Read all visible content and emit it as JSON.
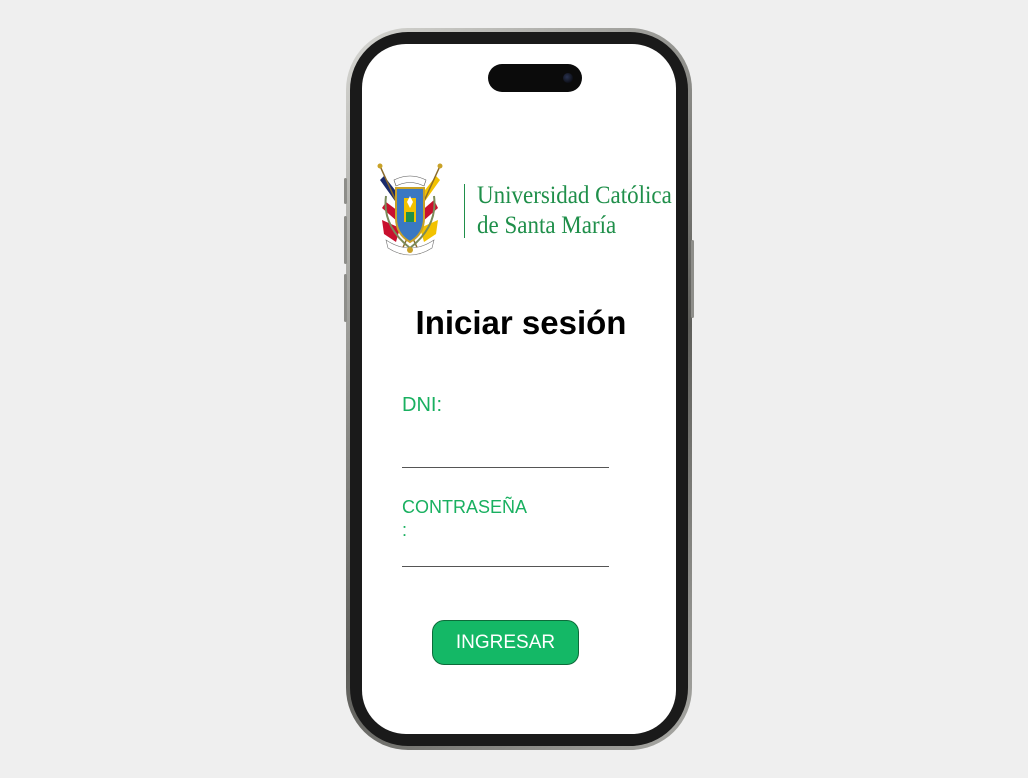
{
  "brand": {
    "name_line1": "Universidad Católica",
    "name_line2": "de Santa María",
    "color": "#1f8f4a",
    "crest_icon": "university-crest-icon"
  },
  "login": {
    "title": "Iniciar sesión",
    "dni_label": "DNI:",
    "dni_value": "",
    "password_label": "CONTRASEÑA\n:",
    "password_value": "",
    "submit_label": "INGRESAR",
    "accent_color": "#19b060"
  },
  "device": {
    "type": "phone-mockup",
    "camera_icon": "front-camera-icon"
  }
}
